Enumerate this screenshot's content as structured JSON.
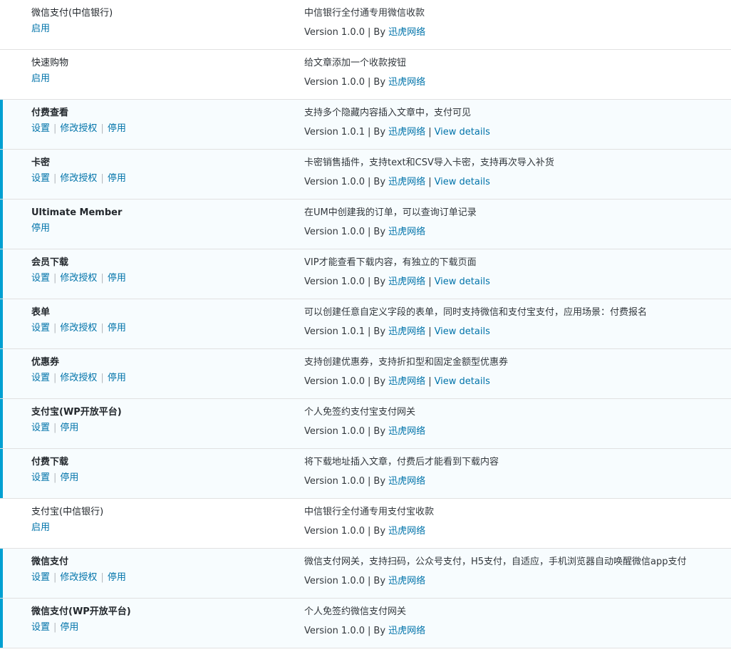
{
  "accent_color": "#00a0d2",
  "link_color": "#0073aa",
  "plugins": [
    {
      "name": "微信支付(中信银行)",
      "active": false,
      "actions": [
        "启用"
      ],
      "description": "中信银行全付通专用微信收款",
      "version": "Version 1.0.0",
      "by": "By",
      "author": "迅虎网络",
      "details": null
    },
    {
      "name": "快速购物",
      "active": false,
      "actions": [
        "启用"
      ],
      "description": "给文章添加一个收款按钮",
      "version": "Version 1.0.0",
      "by": "By",
      "author": "迅虎网络",
      "details": null
    },
    {
      "name": "付费查看",
      "active": true,
      "actions": [
        "设置",
        "修改授权",
        "停用"
      ],
      "description": "支持多个隐藏内容插入文章中，支付可见",
      "version": "Version 1.0.1",
      "by": "By",
      "author": "迅虎网络",
      "details": "View details"
    },
    {
      "name": "卡密",
      "active": true,
      "actions": [
        "设置",
        "修改授权",
        "停用"
      ],
      "description": "卡密销售插件，支持text和CSV导入卡密，支持再次导入补货",
      "version": "Version 1.0.0",
      "by": "By",
      "author": "迅虎网络",
      "details": "View details"
    },
    {
      "name": "Ultimate Member",
      "active": true,
      "actions": [
        "停用"
      ],
      "description": "在UM中创建我的订单，可以查询订单记录",
      "version": "Version 1.0.0",
      "by": "By",
      "author": "迅虎网络",
      "details": null
    },
    {
      "name": "会员下载",
      "active": true,
      "actions": [
        "设置",
        "修改授权",
        "停用"
      ],
      "description": "VIP才能查看下载内容，有独立的下载页面",
      "version": "Version 1.0.0",
      "by": "By",
      "author": "迅虎网络",
      "details": "View details"
    },
    {
      "name": "表单",
      "active": true,
      "actions": [
        "设置",
        "修改授权",
        "停用"
      ],
      "description": "可以创建任意自定义字段的表单，同时支持微信和支付宝支付，应用场景：付费报名",
      "version": "Version 1.0.1",
      "by": "By",
      "author": "迅虎网络",
      "details": "View details"
    },
    {
      "name": "优惠券",
      "active": true,
      "actions": [
        "设置",
        "修改授权",
        "停用"
      ],
      "description": "支持创建优惠券，支持折扣型和固定金额型优惠券",
      "version": "Version 1.0.0",
      "by": "By",
      "author": "迅虎网络",
      "details": "View details"
    },
    {
      "name": "支付宝(WP开放平台)",
      "active": true,
      "actions": [
        "设置",
        "停用"
      ],
      "description": "个人免签约支付宝支付网关",
      "version": "Version 1.0.0",
      "by": "By",
      "author": "迅虎网络",
      "details": null
    },
    {
      "name": "付费下载",
      "active": true,
      "actions": [
        "设置",
        "停用"
      ],
      "description": "将下载地址插入文章，付费后才能看到下载内容",
      "version": "Version 1.0.0",
      "by": "By",
      "author": "迅虎网络",
      "details": null
    },
    {
      "name": "支付宝(中信银行)",
      "active": false,
      "actions": [
        "启用"
      ],
      "description": "中信银行全付通专用支付宝收款",
      "version": "Version 1.0.0",
      "by": "By",
      "author": "迅虎网络",
      "details": null
    },
    {
      "name": "微信支付",
      "active": true,
      "actions": [
        "设置",
        "修改授权",
        "停用"
      ],
      "description": "微信支付网关，支持扫码，公众号支付，H5支付，自适应，手机浏览器自动唤醒微信app支付",
      "version": "Version 1.0.0",
      "by": "By",
      "author": "迅虎网络",
      "details": null
    },
    {
      "name": "微信支付(WP开放平台)",
      "active": true,
      "actions": [
        "设置",
        "停用"
      ],
      "description": "个人免签约微信支付网关",
      "version": "Version 1.0.0",
      "by": "By",
      "author": "迅虎网络",
      "details": null
    }
  ]
}
